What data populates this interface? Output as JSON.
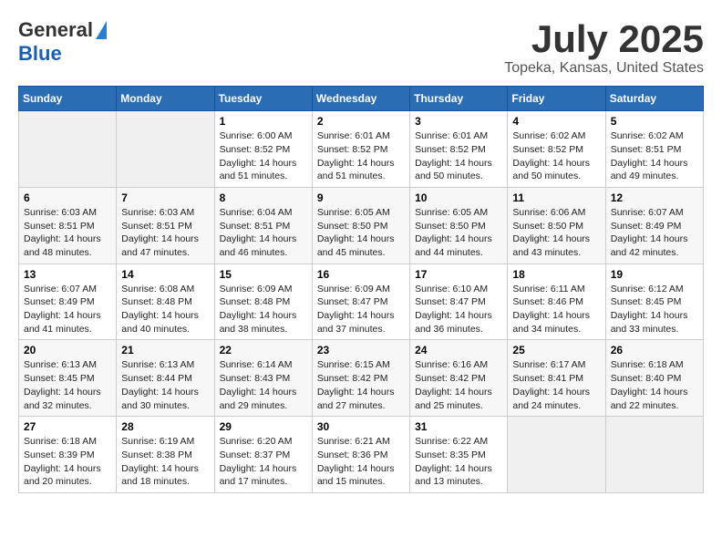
{
  "header": {
    "logo_general": "General",
    "logo_blue": "Blue",
    "month_title": "July 2025",
    "location": "Topeka, Kansas, United States"
  },
  "calendar": {
    "days_of_week": [
      "Sunday",
      "Monday",
      "Tuesday",
      "Wednesday",
      "Thursday",
      "Friday",
      "Saturday"
    ],
    "weeks": [
      [
        {
          "day": "",
          "empty": true
        },
        {
          "day": "",
          "empty": true
        },
        {
          "day": "1",
          "sunrise": "Sunrise: 6:00 AM",
          "sunset": "Sunset: 8:52 PM",
          "daylight": "Daylight: 14 hours and 51 minutes."
        },
        {
          "day": "2",
          "sunrise": "Sunrise: 6:01 AM",
          "sunset": "Sunset: 8:52 PM",
          "daylight": "Daylight: 14 hours and 51 minutes."
        },
        {
          "day": "3",
          "sunrise": "Sunrise: 6:01 AM",
          "sunset": "Sunset: 8:52 PM",
          "daylight": "Daylight: 14 hours and 50 minutes."
        },
        {
          "day": "4",
          "sunrise": "Sunrise: 6:02 AM",
          "sunset": "Sunset: 8:52 PM",
          "daylight": "Daylight: 14 hours and 50 minutes."
        },
        {
          "day": "5",
          "sunrise": "Sunrise: 6:02 AM",
          "sunset": "Sunset: 8:51 PM",
          "daylight": "Daylight: 14 hours and 49 minutes."
        }
      ],
      [
        {
          "day": "6",
          "sunrise": "Sunrise: 6:03 AM",
          "sunset": "Sunset: 8:51 PM",
          "daylight": "Daylight: 14 hours and 48 minutes."
        },
        {
          "day": "7",
          "sunrise": "Sunrise: 6:03 AM",
          "sunset": "Sunset: 8:51 PM",
          "daylight": "Daylight: 14 hours and 47 minutes."
        },
        {
          "day": "8",
          "sunrise": "Sunrise: 6:04 AM",
          "sunset": "Sunset: 8:51 PM",
          "daylight": "Daylight: 14 hours and 46 minutes."
        },
        {
          "day": "9",
          "sunrise": "Sunrise: 6:05 AM",
          "sunset": "Sunset: 8:50 PM",
          "daylight": "Daylight: 14 hours and 45 minutes."
        },
        {
          "day": "10",
          "sunrise": "Sunrise: 6:05 AM",
          "sunset": "Sunset: 8:50 PM",
          "daylight": "Daylight: 14 hours and 44 minutes."
        },
        {
          "day": "11",
          "sunrise": "Sunrise: 6:06 AM",
          "sunset": "Sunset: 8:50 PM",
          "daylight": "Daylight: 14 hours and 43 minutes."
        },
        {
          "day": "12",
          "sunrise": "Sunrise: 6:07 AM",
          "sunset": "Sunset: 8:49 PM",
          "daylight": "Daylight: 14 hours and 42 minutes."
        }
      ],
      [
        {
          "day": "13",
          "sunrise": "Sunrise: 6:07 AM",
          "sunset": "Sunset: 8:49 PM",
          "daylight": "Daylight: 14 hours and 41 minutes."
        },
        {
          "day": "14",
          "sunrise": "Sunrise: 6:08 AM",
          "sunset": "Sunset: 8:48 PM",
          "daylight": "Daylight: 14 hours and 40 minutes."
        },
        {
          "day": "15",
          "sunrise": "Sunrise: 6:09 AM",
          "sunset": "Sunset: 8:48 PM",
          "daylight": "Daylight: 14 hours and 38 minutes."
        },
        {
          "day": "16",
          "sunrise": "Sunrise: 6:09 AM",
          "sunset": "Sunset: 8:47 PM",
          "daylight": "Daylight: 14 hours and 37 minutes."
        },
        {
          "day": "17",
          "sunrise": "Sunrise: 6:10 AM",
          "sunset": "Sunset: 8:47 PM",
          "daylight": "Daylight: 14 hours and 36 minutes."
        },
        {
          "day": "18",
          "sunrise": "Sunrise: 6:11 AM",
          "sunset": "Sunset: 8:46 PM",
          "daylight": "Daylight: 14 hours and 34 minutes."
        },
        {
          "day": "19",
          "sunrise": "Sunrise: 6:12 AM",
          "sunset": "Sunset: 8:45 PM",
          "daylight": "Daylight: 14 hours and 33 minutes."
        }
      ],
      [
        {
          "day": "20",
          "sunrise": "Sunrise: 6:13 AM",
          "sunset": "Sunset: 8:45 PM",
          "daylight": "Daylight: 14 hours and 32 minutes."
        },
        {
          "day": "21",
          "sunrise": "Sunrise: 6:13 AM",
          "sunset": "Sunset: 8:44 PM",
          "daylight": "Daylight: 14 hours and 30 minutes."
        },
        {
          "day": "22",
          "sunrise": "Sunrise: 6:14 AM",
          "sunset": "Sunset: 8:43 PM",
          "daylight": "Daylight: 14 hours and 29 minutes."
        },
        {
          "day": "23",
          "sunrise": "Sunrise: 6:15 AM",
          "sunset": "Sunset: 8:42 PM",
          "daylight": "Daylight: 14 hours and 27 minutes."
        },
        {
          "day": "24",
          "sunrise": "Sunrise: 6:16 AM",
          "sunset": "Sunset: 8:42 PM",
          "daylight": "Daylight: 14 hours and 25 minutes."
        },
        {
          "day": "25",
          "sunrise": "Sunrise: 6:17 AM",
          "sunset": "Sunset: 8:41 PM",
          "daylight": "Daylight: 14 hours and 24 minutes."
        },
        {
          "day": "26",
          "sunrise": "Sunrise: 6:18 AM",
          "sunset": "Sunset: 8:40 PM",
          "daylight": "Daylight: 14 hours and 22 minutes."
        }
      ],
      [
        {
          "day": "27",
          "sunrise": "Sunrise: 6:18 AM",
          "sunset": "Sunset: 8:39 PM",
          "daylight": "Daylight: 14 hours and 20 minutes."
        },
        {
          "day": "28",
          "sunrise": "Sunrise: 6:19 AM",
          "sunset": "Sunset: 8:38 PM",
          "daylight": "Daylight: 14 hours and 18 minutes."
        },
        {
          "day": "29",
          "sunrise": "Sunrise: 6:20 AM",
          "sunset": "Sunset: 8:37 PM",
          "daylight": "Daylight: 14 hours and 17 minutes."
        },
        {
          "day": "30",
          "sunrise": "Sunrise: 6:21 AM",
          "sunset": "Sunset: 8:36 PM",
          "daylight": "Daylight: 14 hours and 15 minutes."
        },
        {
          "day": "31",
          "sunrise": "Sunrise: 6:22 AM",
          "sunset": "Sunset: 8:35 PM",
          "daylight": "Daylight: 14 hours and 13 minutes."
        },
        {
          "day": "",
          "empty": true
        },
        {
          "day": "",
          "empty": true
        }
      ]
    ]
  }
}
